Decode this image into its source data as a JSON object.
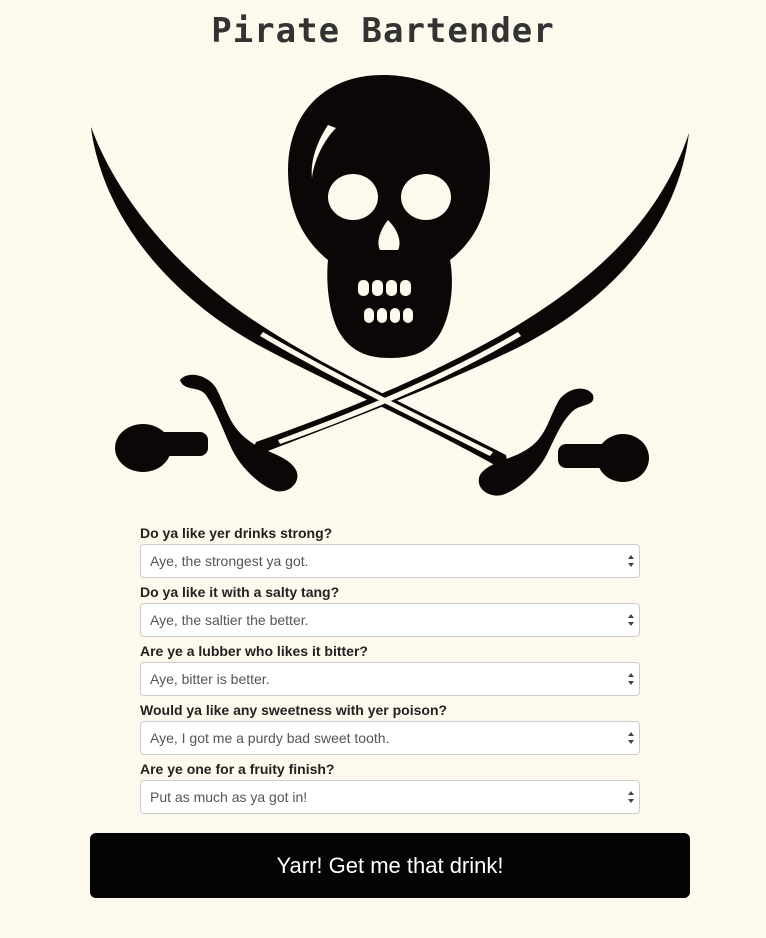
{
  "header": {
    "title": "Pirate Bartender"
  },
  "logo": {
    "icon": "skull-crossbones-icon"
  },
  "questions": [
    {
      "label": "Do ya like yer drinks strong?",
      "selected": "Aye, the strongest ya got."
    },
    {
      "label": "Do ya like it with a salty tang?",
      "selected": "Aye, the saltier the better."
    },
    {
      "label": "Are ye a lubber who likes it bitter?",
      "selected": "Aye, bitter is better."
    },
    {
      "label": "Would ya like any sweetness with yer poison?",
      "selected": "Aye, I got me a purdy bad sweet tooth."
    },
    {
      "label": "Are ye one for a fruity finish?",
      "selected": "Put as much as ya got in!"
    }
  ],
  "submit": {
    "label": "Yarr! Get me that drink!"
  },
  "colors": {
    "background": "#fdf9ed",
    "button": "#040404",
    "logo": "#0d0606"
  }
}
